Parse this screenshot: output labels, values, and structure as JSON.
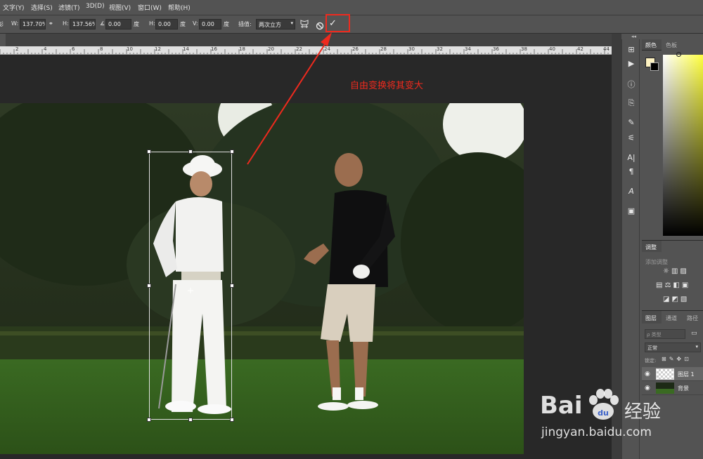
{
  "menu": [
    "文字(Y)",
    "选择(S)",
    "滤镜(T)",
    "3D(D)",
    "视图(V)",
    "窗口(W)",
    "帮助(H)"
  ],
  "options": {
    "left_fragment": "彭",
    "w_label": "W:",
    "w_value": "137.70%",
    "h_label": "H:",
    "h_value": "137.56%",
    "angle_value": "0.00",
    "deg1": "度",
    "hskew_label": "H:",
    "hskew_value": "0.00",
    "deg2": "度",
    "vskew_label": "V:",
    "vskew_value": "0.00",
    "deg3": "度",
    "interp_label": "插值:",
    "interp_value": "两次立方",
    "commit_glyph": "✓"
  },
  "ruler": [
    "2",
    "4",
    "6",
    "8",
    "10",
    "12",
    "14",
    "16",
    "18",
    "20",
    "22",
    "24",
    "26",
    "28",
    "30",
    "32",
    "34",
    "36",
    "38",
    "40",
    "42",
    "44"
  ],
  "annotation": "自由变换将其变大",
  "panels": {
    "color_tab": "颜色",
    "swatches_tab": "色板",
    "adjust_tab": "调整",
    "adjust_add": "添加调整",
    "layers_tab": "图层",
    "channels_tab": "通道",
    "paths_tab": "路径",
    "kind_filter": "ρ 类型",
    "blend_mode": "正常",
    "lock_label": "锁定:",
    "layers": [
      {
        "name": "图层 1"
      },
      {
        "name": "背景"
      }
    ]
  },
  "watermark": {
    "brand_left": "Bai",
    "brand_right": "经验",
    "url": "jingyan.baidu.com"
  },
  "colors": {
    "annotation_red": "#ee2a1e",
    "ui_gray": "#535353",
    "canvas_bg": "#282828"
  }
}
